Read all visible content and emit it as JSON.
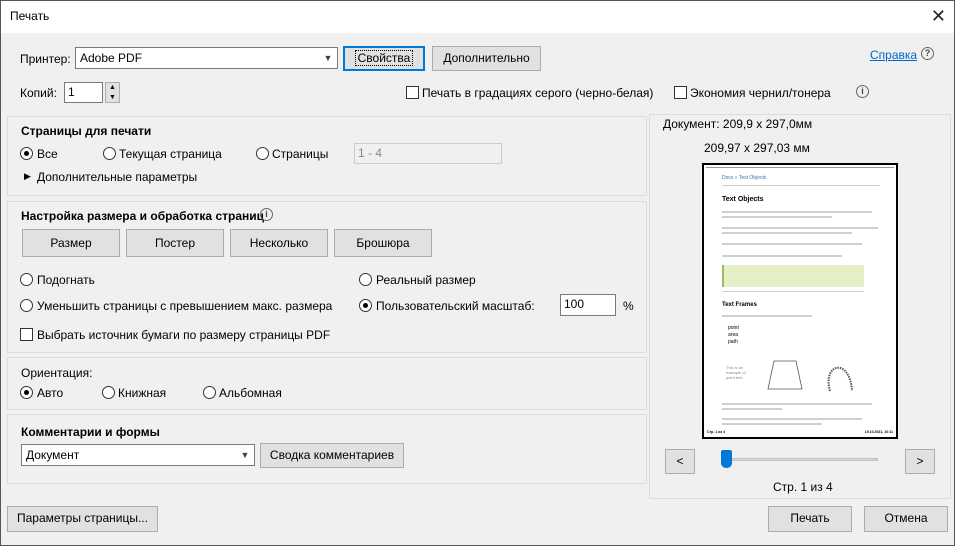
{
  "window": {
    "title": "Печать",
    "close_glyph": "✕"
  },
  "printer": {
    "label": "Принтер:",
    "value": "Adobe PDF",
    "properties_button": "Свойства",
    "advanced_button": "Дополнительно",
    "help_link": "Справка",
    "help_icon": "?"
  },
  "copies": {
    "label": "Копий:",
    "value": "1"
  },
  "options": {
    "grayscale": "Печать в градациях серого (черно-белая)",
    "save_ink": "Экономия чернил/тонера",
    "info_icon": "i"
  },
  "pages": {
    "title": "Страницы для печати",
    "all": "Все",
    "current": "Текущая страница",
    "pages": "Страницы",
    "range_placeholder": "1 - 4",
    "more": "Дополнительные параметры",
    "selected": "all"
  },
  "sizing": {
    "title": "Настройка размера и обработка страниц",
    "buttons": [
      "Размер",
      "Постер",
      "Несколько",
      "Брошюра"
    ],
    "fit": "Подогнать",
    "actual": "Реальный размер",
    "shrink": "Уменьшить страницы с превышением макс. размера",
    "custom": "Пользовательский масштаб:",
    "custom_value": "100",
    "percent": "%",
    "paper_source": "Выбрать источник бумаги по размеру страницы PDF",
    "selected": "custom"
  },
  "orientation": {
    "title": "Ориентация:",
    "auto": "Авто",
    "portrait": "Книжная",
    "landscape": "Альбомная",
    "selected": "auto"
  },
  "comments": {
    "title": "Комментарии и формы",
    "value": "Документ",
    "summary_button": "Сводка комментариев"
  },
  "preview": {
    "doc_size": "Документ: 209,9 x 297,0мм",
    "page_size": "209,97 x 297,03 мм",
    "prev": "<",
    "next": ">",
    "page_status": "Стр. 1 из 4",
    "page_current": 1,
    "page_total": 4,
    "thumb": {
      "breadcrumb": "Docs » Text Objects",
      "h1": "Text Objects",
      "h2": "Text Frames",
      "bullets": [
        "point",
        "area",
        "path"
      ],
      "footer_left": "Стр. 1 из 4",
      "footer_right": "19.10.2021, 10:11"
    }
  },
  "footer": {
    "page_setup": "Параметры страницы...",
    "print": "Печать",
    "cancel": "Отмена"
  },
  "colors": {
    "accent": "#0078d7",
    "link": "#0066cc"
  }
}
